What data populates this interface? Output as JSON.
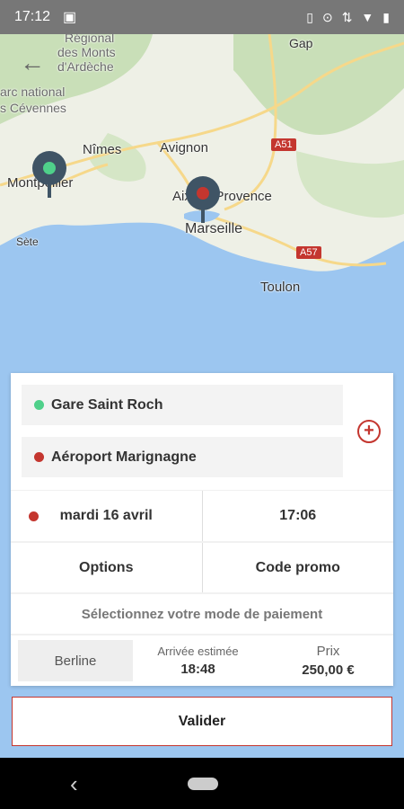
{
  "status_bar": {
    "time": "17:12"
  },
  "map": {
    "labels": {
      "regional": "Régional",
      "des_monts": "des Monts",
      "d_ardeche": "d'Ardèche",
      "parc_national": "arc national",
      "cevennes": "s Cévennes",
      "gap": "Gap",
      "nimes": "Nîmes",
      "avignon": "Avignon",
      "montpellier": "Montpellier",
      "aix": "Aix-en-Provence",
      "marseille": "Marseille",
      "sete": "Sète",
      "toulon": "Toulon",
      "a51": "A51",
      "a57": "A57"
    },
    "pins": {
      "origin_color": "#4fd08a",
      "destination_color": "#c4362f"
    }
  },
  "booking": {
    "pickup": "Gare Saint Roch",
    "dropoff": "Aéroport Marignagne",
    "date": "mardi 16 avril",
    "time": "17:06",
    "options_label": "Options",
    "promo_label": "Code promo",
    "payment_label": "Sélectionnez votre mode de paiement",
    "vehicle": "Berline",
    "eta_label": "Arrivée estimée",
    "eta_value": "18:48",
    "price_label": "Prix",
    "price_value": "250,00 €",
    "submit_label": "Valider"
  },
  "colors": {
    "accent": "#c4362f",
    "pin_body": "#3f5465"
  }
}
